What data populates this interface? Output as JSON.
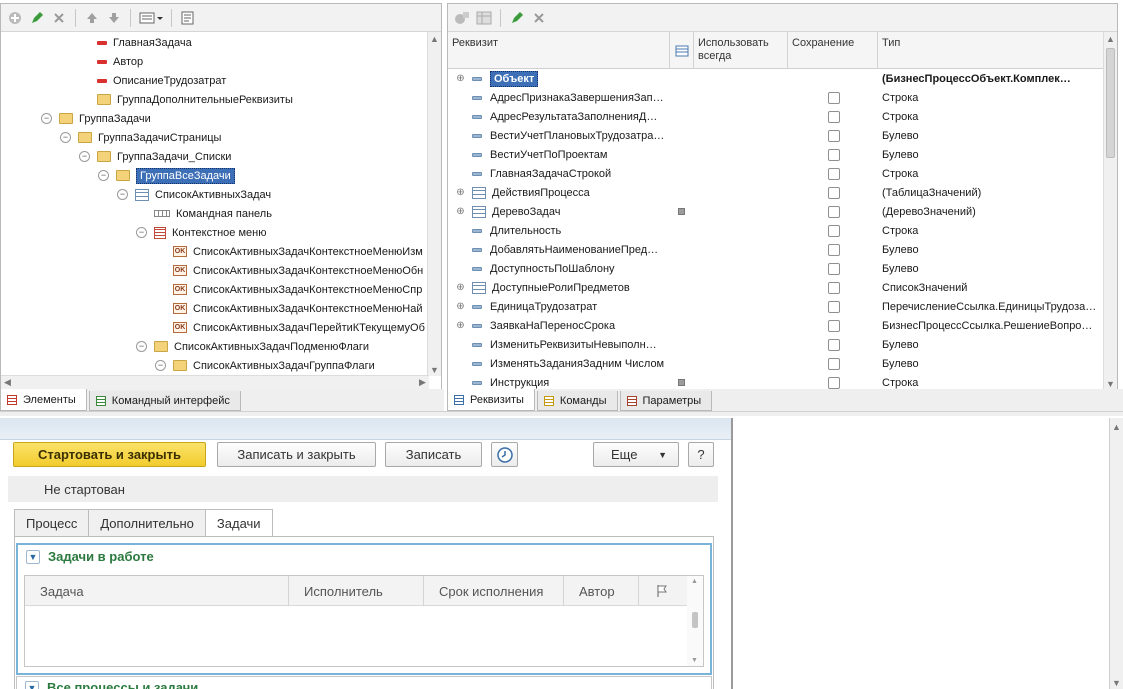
{
  "left_panel": {
    "tree": [
      {
        "label": "ГлавнаяЗадача",
        "icon": "red-dash-icon",
        "indent": 4
      },
      {
        "label": "Автор",
        "icon": "red-dash-icon",
        "indent": 4
      },
      {
        "label": "ОписаниеТрудозатрат",
        "icon": "red-dash-icon",
        "indent": 4
      },
      {
        "label": "ГруппаДополнительныеРеквизиты",
        "icon": "folder-icon",
        "indent": 4
      },
      {
        "label": "ГруппаЗадачи",
        "icon": "folder-icon",
        "indent": 2,
        "toggle": "⊖"
      },
      {
        "label": "ГруппаЗадачиСтраницы",
        "icon": "folder-icon",
        "indent": 3,
        "toggle": "⊖"
      },
      {
        "label": "ГруппаЗадачи_Списки",
        "icon": "folder-icon",
        "indent": 4,
        "toggle": "⊖"
      },
      {
        "label": "ГруппаВсеЗадачи",
        "icon": "folder-icon",
        "indent": 5,
        "toggle": "⊖",
        "selected": true
      },
      {
        "label": "СписокАктивныхЗадач",
        "icon": "table-icon",
        "indent": 6,
        "toggle": "⊖"
      },
      {
        "label": "Командная панель",
        "icon": "command-bar-icon",
        "indent": 7
      },
      {
        "label": "Контекстное меню",
        "icon": "context-menu-icon",
        "indent": 7,
        "toggle": "⊖"
      },
      {
        "label": "СписокАктивныхЗадачКонтекстноеМенюИзм",
        "icon": "ok-icon",
        "indent": 8
      },
      {
        "label": "СписокАктивныхЗадачКонтекстноеМенюОбн",
        "icon": "ok-icon",
        "indent": 8
      },
      {
        "label": "СписокАктивныхЗадачКонтекстноеМенюСпр",
        "icon": "ok-icon",
        "indent": 8
      },
      {
        "label": "СписокАктивныхЗадачКонтекстноеМенюНай",
        "icon": "ok-icon",
        "indent": 8
      },
      {
        "label": "СписокАктивныхЗадачПерейтиКТекущемуОб",
        "icon": "ok-icon",
        "indent": 8
      },
      {
        "label": "СписокАктивныхЗадачПодменюФлаги",
        "icon": "folder-icon",
        "indent": 7,
        "toggle": "⊖"
      },
      {
        "label": "СписокАктивныхЗадачГруппаФлаги",
        "icon": "folder-icon",
        "indent": 8,
        "toggle": "⊖"
      }
    ],
    "tabs": [
      {
        "label": "Элементы",
        "active": true
      },
      {
        "label": "Командный интерфейс",
        "active": false
      }
    ]
  },
  "right_panel": {
    "columns": {
      "requisite": "Реквизит",
      "use_always": "Использовать всегда",
      "saving": "Сохранение",
      "type": "Тип"
    },
    "rows": [
      {
        "name": "Объект",
        "type": "(БизнесПроцессОбъект.Комплек…",
        "expand": true,
        "selected": true,
        "checkbox": false,
        "marker": false
      },
      {
        "name": "АдресПризнакаЗавершенияЗап…",
        "type": "Строка",
        "checkbox": true
      },
      {
        "name": "АдресРезультатаЗаполненияД…",
        "type": "Строка",
        "checkbox": true
      },
      {
        "name": "ВестиУчетПлановыхТрудозатра…",
        "type": "Булево",
        "checkbox": true
      },
      {
        "name": "ВестиУчетПоПроектам",
        "type": "Булево",
        "checkbox": true
      },
      {
        "name": "ГлавнаяЗадачаСтрокой",
        "type": "Строка",
        "checkbox": true
      },
      {
        "name": "ДействияПроцесса",
        "type": "(ТаблицаЗначений)",
        "expand": true,
        "table_icon": true,
        "checkbox": true
      },
      {
        "name": "ДеревоЗадач",
        "type": "(ДеревоЗначений)",
        "expand": true,
        "table_icon": true,
        "checkbox": true,
        "marker": true
      },
      {
        "name": "Длительность",
        "type": "Строка",
        "checkbox": true
      },
      {
        "name": "ДобавлятьНаименованиеПред…",
        "type": "Булево",
        "checkbox": true
      },
      {
        "name": "ДоступностьПоШаблону",
        "type": "Булево",
        "checkbox": true
      },
      {
        "name": "ДоступныеРолиПредметов",
        "type": "СписокЗначений",
        "expand": true,
        "table_icon": true,
        "checkbox": true
      },
      {
        "name": "ЕдиницаТрудозатрат",
        "type": "ПеречислениеСсылка.ЕдиницыТрудоза…",
        "expand": true,
        "checkbox": true
      },
      {
        "name": "ЗаявкаНаПереносСрока",
        "type": "БизнесПроцессСсылка.РешениеВопро…",
        "expand": true,
        "checkbox": true
      },
      {
        "name": "ИзменитьРеквизитыНевыполн…",
        "type": "Булево",
        "checkbox": true
      },
      {
        "name": "ИзменятьЗаданияЗадним Числом",
        "type": "Булево",
        "checkbox": true
      },
      {
        "name": "Инструкция",
        "type": "Строка",
        "checkbox": true,
        "marker": true
      }
    ],
    "tabs": [
      {
        "label": "Реквизиты",
        "active": true
      },
      {
        "label": "Команды",
        "active": false
      },
      {
        "label": "Параметры",
        "active": false
      }
    ]
  },
  "form": {
    "buttons": {
      "start_close": "Стартовать и закрыть",
      "save_close": "Записать и закрыть",
      "save": "Записать",
      "more": "Еще",
      "help": "?"
    },
    "status": "Не стартован",
    "tabs": [
      {
        "label": "Процесс",
        "active": false
      },
      {
        "label": "Дополнительно",
        "active": false
      },
      {
        "label": "Задачи",
        "active": true
      }
    ],
    "group_title": "Задачи в работе",
    "table_columns": [
      "Задача",
      "Исполнитель",
      "Срок исполнения",
      "Автор"
    ],
    "group2_title": "Все процессы и задачи"
  },
  "colors": {
    "selection": "#3d6fb6",
    "accent_yellow": "#f2cc2d",
    "group_green": "#2b7a3f",
    "group_border": "#79b3da"
  }
}
